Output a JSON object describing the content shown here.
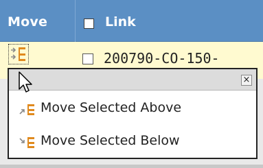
{
  "header": {
    "move_label": "Move",
    "link_label": "Link"
  },
  "row": {
    "link_text": "200790-CO-150-"
  },
  "popup": {
    "close_label": "×",
    "items": [
      {
        "label": "Move Selected Above",
        "icon": "move-above-icon"
      },
      {
        "label": "Move Selected Below",
        "icon": "move-below-icon"
      }
    ]
  },
  "colors": {
    "header_bg": "#5b8fc4",
    "row_highlight": "#fffad0",
    "icon_orange": "#e08a1e",
    "icon_gray": "#8a8a8a"
  }
}
